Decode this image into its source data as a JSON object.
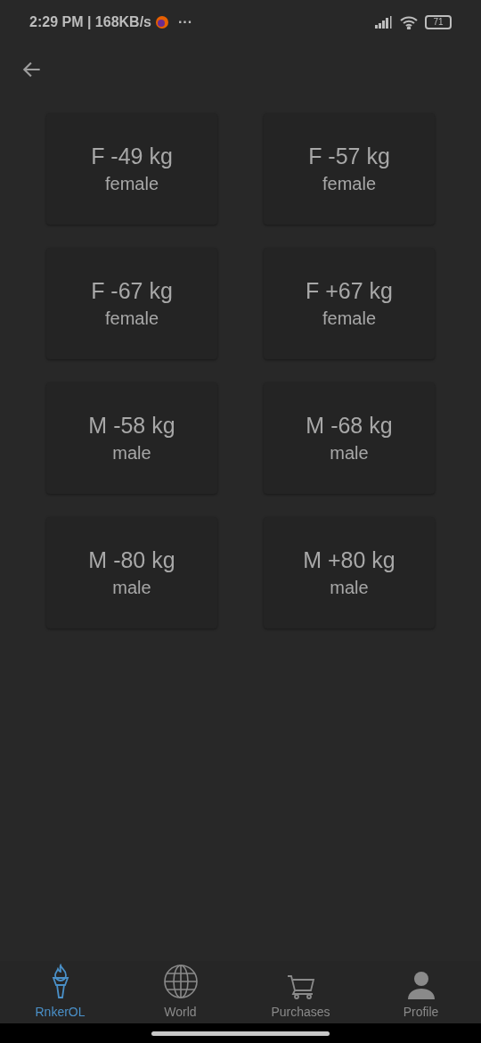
{
  "status_bar": {
    "time": "2:29 PM | 168KB/s",
    "more": "···",
    "battery": "71"
  },
  "categories": [
    {
      "title": "F -49 kg",
      "subtitle": "female"
    },
    {
      "title": "F -57 kg",
      "subtitle": "female"
    },
    {
      "title": "F -67 kg",
      "subtitle": "female"
    },
    {
      "title": "F +67 kg",
      "subtitle": "female"
    },
    {
      "title": "M -58 kg",
      "subtitle": "male"
    },
    {
      "title": "M -68 kg",
      "subtitle": "male"
    },
    {
      "title": "M -80 kg",
      "subtitle": "male"
    },
    {
      "title": "M +80 kg",
      "subtitle": "male"
    }
  ],
  "bottom_nav": [
    {
      "kind": "torch",
      "label": "RnkerOL",
      "selected": true
    },
    {
      "kind": "globe",
      "label": "World",
      "selected": false
    },
    {
      "kind": "cart",
      "label": "Purchases",
      "selected": false
    },
    {
      "kind": "person",
      "label": "Profile",
      "selected": false
    }
  ]
}
